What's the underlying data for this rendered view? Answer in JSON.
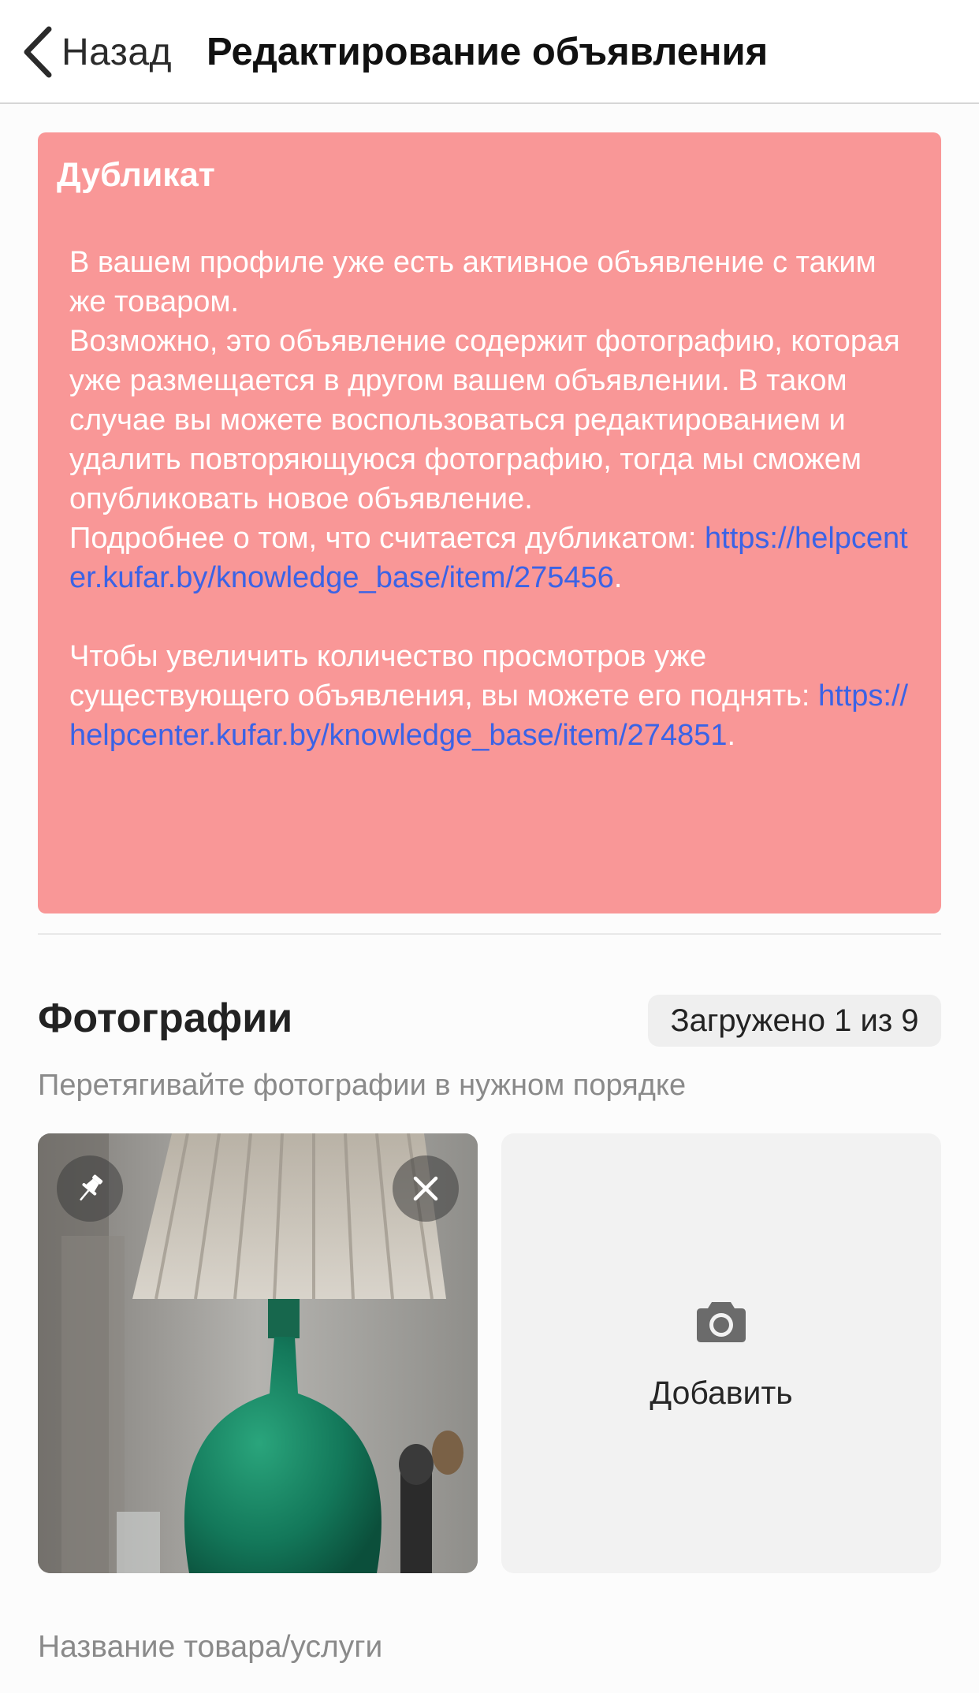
{
  "nav": {
    "back_label": "Назад",
    "title": "Редактирование объявления"
  },
  "alert": {
    "title": "Дубликат",
    "p1": "В вашем профиле уже есть активное объявление с таким же товаром.",
    "p2": "Возможно, это объявление содержит фотографию, которая уже размещается в другом вашем объявлении. В таком случае вы можете воспользоваться редактированием и удалить повторяющуюся фотографию, тогда мы сможем опубликовать новое объявление.",
    "p3_text": "Подробнее о том, что считается дубликатом: ",
    "p3_link": "https://helpcenter.kufar.by/knowledge_base/item/275456",
    "p3_end": ".",
    "p4_text": "Чтобы увеличить количество просмотров уже существующего объявления, вы можете его поднять: ",
    "p4_link": "https://helpcenter.kufar.by/knowledge_base/item/274851",
    "p4_end": "."
  },
  "photos": {
    "title": "Фотографии",
    "uploaded_badge": "Загружено 1 из 9",
    "hint": "Перетягивайте фотографии в нужном порядке",
    "add_label": "Добавить",
    "icons": {
      "pin": "pin-icon",
      "remove": "close-icon",
      "add": "camera-icon"
    }
  },
  "form": {
    "name_label": "Название товара/услуги"
  },
  "colors": {
    "alert_bg": "#f99797",
    "link": "#3a63e6",
    "lamp_green": "#13785a"
  }
}
